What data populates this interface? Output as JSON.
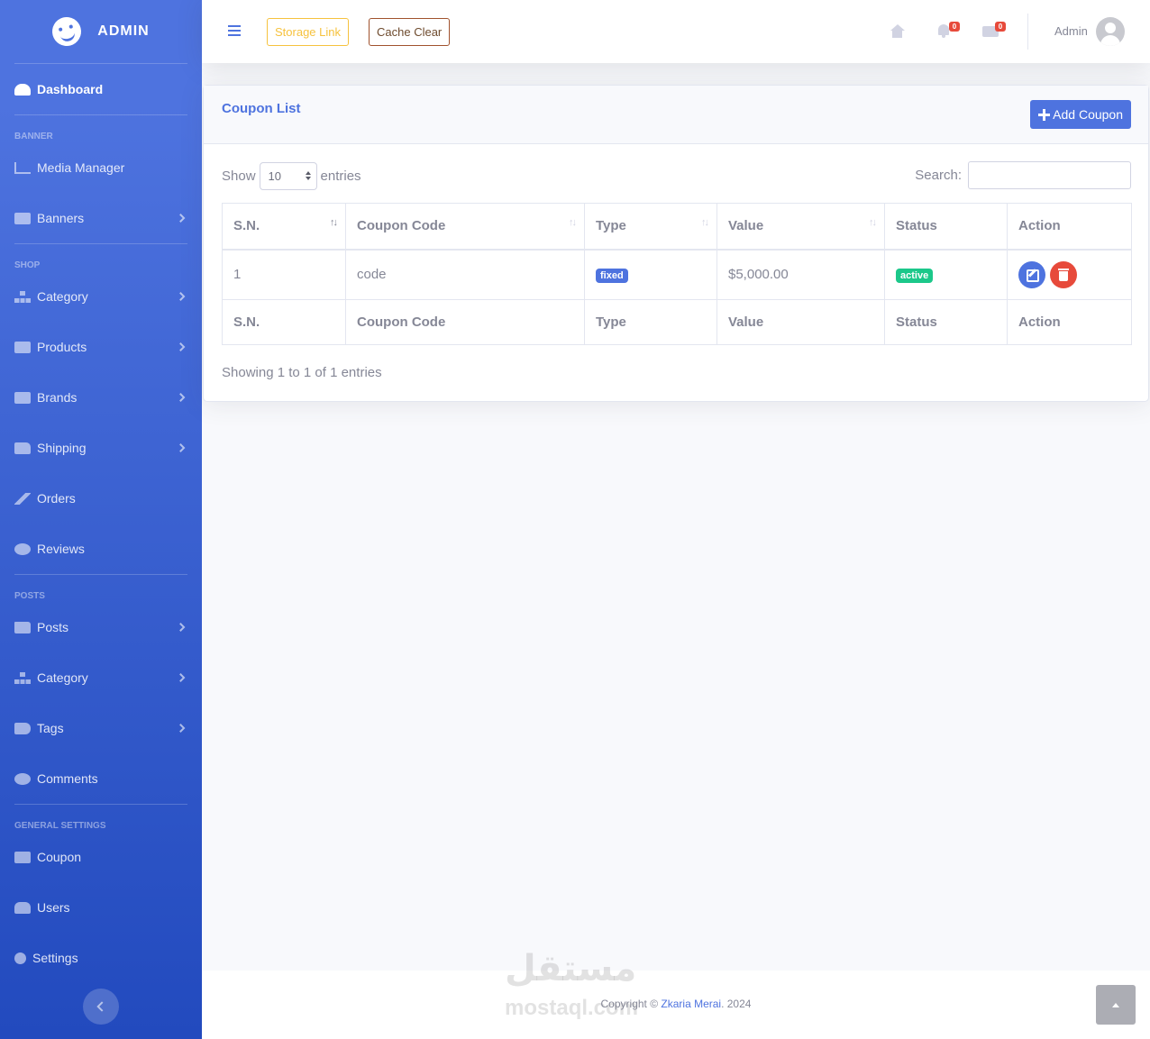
{
  "brand": {
    "name": "ADMIN",
    "icon": "laugh-wink-icon"
  },
  "sidebar": {
    "dashboard": "Dashboard",
    "headings": {
      "banner": "BANNER",
      "shop": "SHOP",
      "posts": "POSTS",
      "general": "GENERAL SETTINGS"
    },
    "items": {
      "media": "Media Manager",
      "banners": "Banners",
      "category": "Category",
      "products": "Products",
      "brands": "Brands",
      "shipping": "Shipping",
      "orders": "Orders",
      "reviews": "Reviews",
      "posts": "Posts",
      "post_category": "Category",
      "tags": "Tags",
      "comments": "Comments",
      "coupon": "Coupon",
      "users": "Users",
      "settings": "Settings"
    }
  },
  "topbar": {
    "storage_link": "Storage Link",
    "cache_clear": "Cache Clear",
    "alerts_count": "0",
    "messages_count": "0",
    "user_name": "Admin"
  },
  "card": {
    "title": "Coupon List",
    "add_button": "Add Coupon",
    "show_label": "Show",
    "entries_label": "entries",
    "page_length": "10",
    "search_label": "Search:",
    "search_value": "",
    "info": "Showing 1 to 1 of 1 entries"
  },
  "table": {
    "headers": [
      "S.N.",
      "Coupon Code",
      "Type",
      "Value",
      "Status",
      "Action"
    ],
    "rows": [
      {
        "sn": "1",
        "code": "code",
        "type": "fixed",
        "value": "$5,000.00",
        "status": "active"
      }
    ]
  },
  "footer": {
    "copyright_prefix": "Copyright ©",
    "author": "Zkaria Merai",
    "year_suffix": ". 2024",
    "watermark_ar": "مستقل",
    "watermark_en": "mostaql.com"
  },
  "colors": {
    "primary": "#4e73df",
    "success": "#1cc88a",
    "danger": "#e74a3b",
    "warning": "#f6c23e"
  }
}
